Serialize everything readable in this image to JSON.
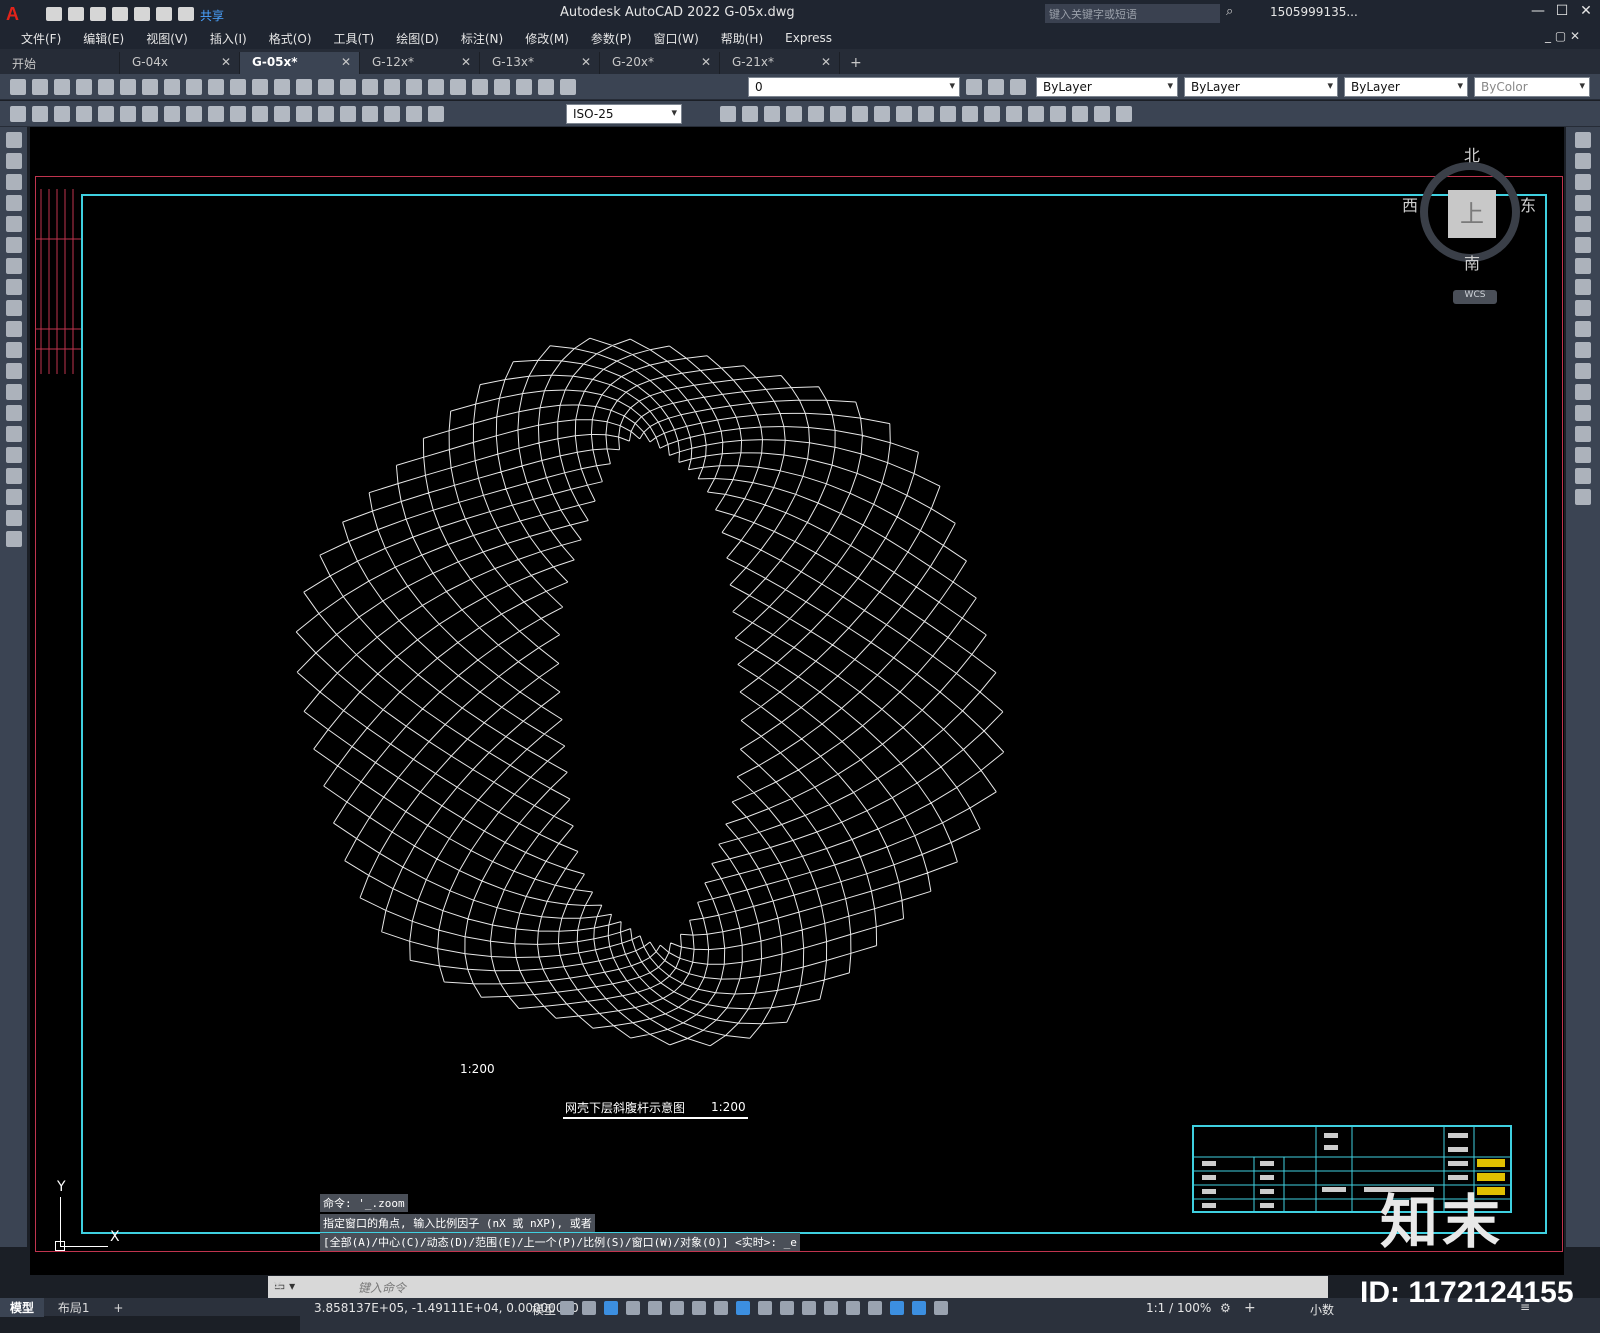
{
  "app": {
    "title": "Autodesk AutoCAD 2022    G-05x.dwg",
    "share_label": "共享",
    "search_placeholder": "键入关键字或短语",
    "user": "1505999135...",
    "logo_letter": "A"
  },
  "menu": [
    "文件(F)",
    "编辑(E)",
    "视图(V)",
    "插入(I)",
    "格式(O)",
    "工具(T)",
    "绘图(D)",
    "标注(N)",
    "修改(M)",
    "参数(P)",
    "窗口(W)",
    "帮助(H)",
    "Express"
  ],
  "tabs": [
    {
      "label": "开始",
      "active": false,
      "closable": false
    },
    {
      "label": "G-04x",
      "active": false,
      "closable": true
    },
    {
      "label": "G-05x*",
      "active": true,
      "closable": true
    },
    {
      "label": "G-12x*",
      "active": false,
      "closable": true
    },
    {
      "label": "G-13x*",
      "active": false,
      "closable": true
    },
    {
      "label": "G-20x*",
      "active": false,
      "closable": true
    },
    {
      "label": "G-21x*",
      "active": false,
      "closable": true
    }
  ],
  "tab_add": "+",
  "toolbar": {
    "layer_value": "0",
    "color_value": "ByLayer",
    "linetype_value": "ByLayer",
    "lineweight_value": "ByLayer",
    "plotstyle_value": "ByColor",
    "dimstyle_value": "ISO-25"
  },
  "viewcube": {
    "north": "北",
    "south": "南",
    "east": "东",
    "west": "西",
    "face": "上",
    "wcs": "WCS"
  },
  "drawing": {
    "scale_label": "1:200",
    "figure_title": "网壳下层斜腹杆示意图",
    "figure_scale": "1:200"
  },
  "ucs": {
    "y": "Y",
    "x": "X"
  },
  "command_history": [
    "命令: '_.zoom",
    "指定窗口的角点, 输入比例因子 (nX 或 nXP), 或者",
    "[全部(A)/中心(C)/动态(D)/范围(E)/上一个(P)/比例(S)/窗口(W)/对象(O)] <实时>: _e"
  ],
  "command_prompt": "键入命令",
  "layout_tabs": [
    {
      "label": "模型",
      "active": true
    },
    {
      "label": "布局1",
      "active": false
    }
  ],
  "layout_add": "+",
  "status": {
    "coords": "3.858137E+05, -1.49111E+04, 0.00000000",
    "model": "模型",
    "scale": "1:1 / 100%",
    "units": "小数"
  },
  "watermark": {
    "logo": "知末",
    "id": "ID: 1172124155"
  }
}
